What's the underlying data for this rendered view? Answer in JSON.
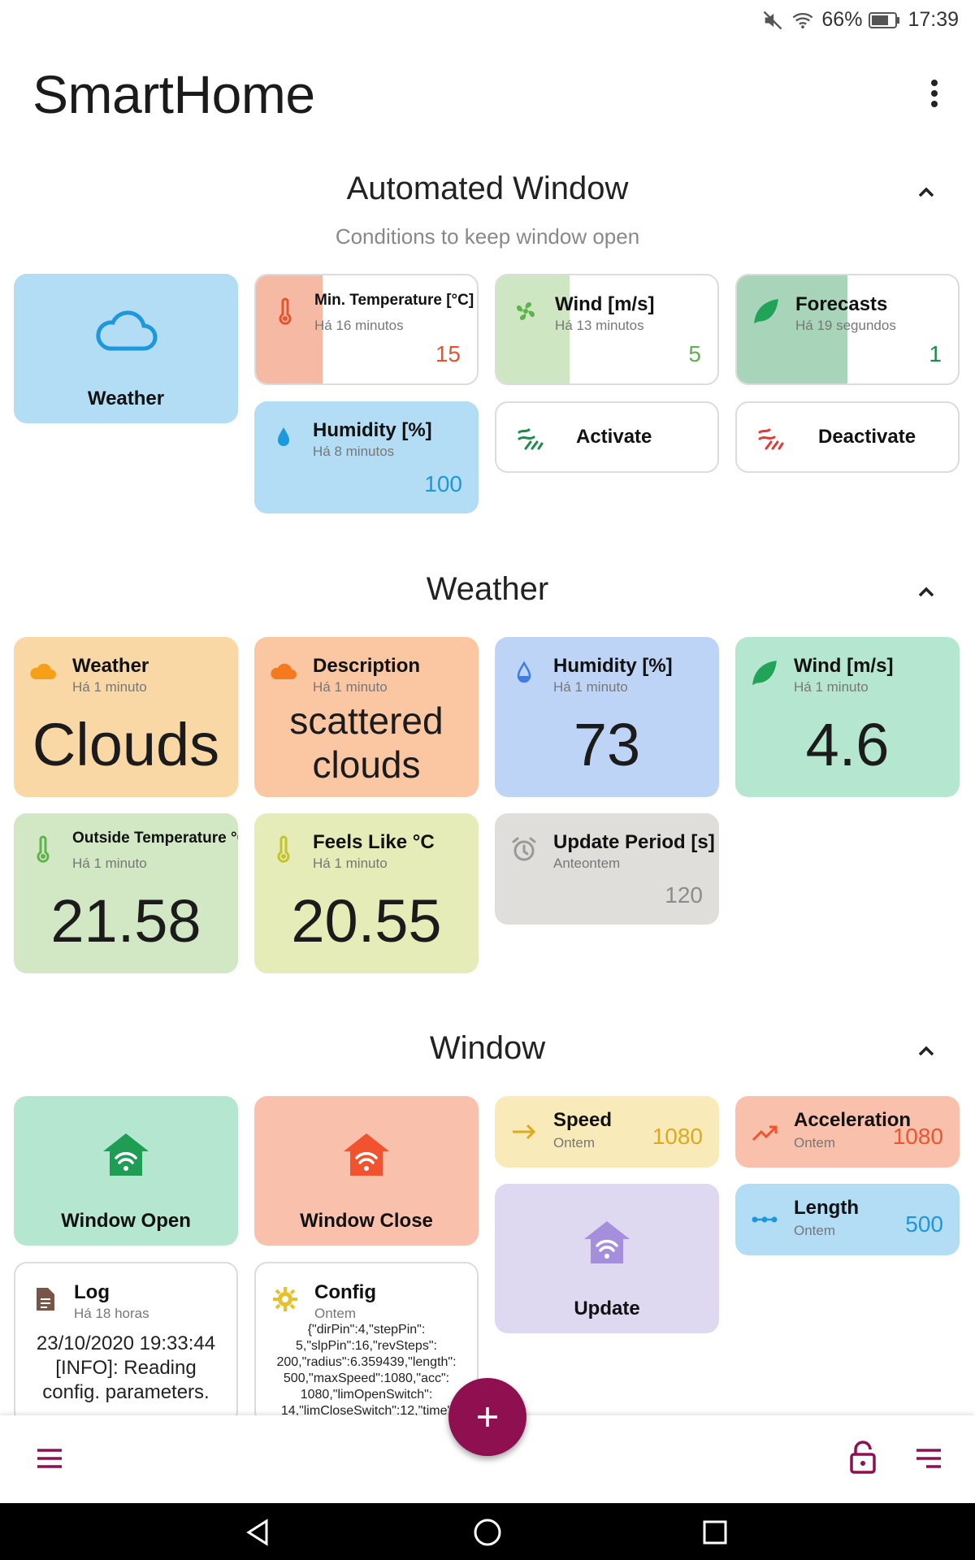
{
  "status": {
    "battery_pct": "66%",
    "time": "17:39"
  },
  "app": {
    "title": "SmartHome"
  },
  "sections": {
    "automated": {
      "title": "Automated Window",
      "subtitle": "Conditions to keep window open"
    },
    "weather": {
      "title": "Weather"
    },
    "window": {
      "title": "Window"
    }
  },
  "automated": {
    "weather_tile": {
      "label": "Weather"
    },
    "min_temp": {
      "title": "Min. Temperature [°C]",
      "sub": "Há 16 minutos",
      "value": "15",
      "level": 0.3
    },
    "wind": {
      "title": "Wind [m/s]",
      "sub": "Há 13 minutos",
      "value": "5",
      "level": 0.33
    },
    "forecasts": {
      "title": "Forecasts",
      "sub": "Há 19 segundos",
      "value": "1",
      "level": 0.5
    },
    "humidity": {
      "title": "Humidity [%]",
      "sub": "Há 8 minutos",
      "value": "100",
      "level": 1.0
    },
    "activate": {
      "label": "Activate"
    },
    "deactivate": {
      "label": "Deactivate"
    }
  },
  "weather": {
    "weather": {
      "title": "Weather",
      "sub": "Há 1 minuto",
      "value": "Clouds"
    },
    "description": {
      "title": "Description",
      "sub": "Há 1 minuto",
      "value_line1": "scattered",
      "value_line2": "clouds"
    },
    "humidity": {
      "title": "Humidity [%]",
      "sub": "Há 1 minuto",
      "value": "73"
    },
    "wind": {
      "title": "Wind [m/s]",
      "sub": "Há 1 minuto",
      "value": "4.6"
    },
    "outside_temp": {
      "title": "Outside Temperature °C",
      "sub": "Há 1 minuto",
      "value": "21.58"
    },
    "feels_like": {
      "title": "Feels Like °C",
      "sub": "Há 1 minuto",
      "value": "20.55"
    },
    "update_period": {
      "title": "Update Period [s]",
      "sub": "Anteontem",
      "value": "120"
    }
  },
  "window": {
    "open": {
      "label": "Window Open"
    },
    "close": {
      "label": "Window Close"
    },
    "speed": {
      "title": "Speed",
      "sub": "Ontem",
      "value": "1080"
    },
    "acceleration": {
      "title": "Acceleration",
      "sub": "Ontem",
      "value": "1080"
    },
    "update": {
      "label": "Update"
    },
    "length": {
      "title": "Length",
      "sub": "Ontem",
      "value": "500"
    },
    "log": {
      "title": "Log",
      "sub": "Há 18 horas",
      "line1": "23/10/2020 19:33:44",
      "line2": "[INFO]: Reading",
      "line3": "config. parameters."
    },
    "config": {
      "title": "Config",
      "sub": "Ontem",
      "line1": "{\"dirPin\":4,\"stepPin\":",
      "line2": "5,\"slpPin\":16,\"revSteps\":",
      "line3": "200,\"radius\":6.359439,\"length\":",
      "line4": "500,\"maxSpeed\":1080,\"acc\":",
      "line5": "1080,\"limOpenSwitch\":",
      "line6": "14,\"limCloseSwitch\":12,\"time\""
    }
  },
  "colors": {
    "accent": "#8e1050",
    "weather_blue": "#b3dcf5",
    "open_green": "#b5e6cf",
    "close_orange": "#f9c0ac"
  },
  "icons": [
    "mute-icon",
    "wifi-icon",
    "battery-icon",
    "more-vert-icon",
    "chevron-up-icon",
    "cloud-icon",
    "thermometer-icon",
    "fan-icon",
    "leaf-icon",
    "drop-icon",
    "wind-on-icon",
    "wind-off-icon",
    "alarm-icon",
    "home-wifi-icon",
    "arrow-right-icon",
    "trending-up-icon",
    "dots-line-icon",
    "document-icon",
    "gear-icon",
    "plus-icon",
    "menu-icon",
    "lock-icon",
    "sort-icon",
    "back-icon",
    "home-icon",
    "recents-icon"
  ]
}
